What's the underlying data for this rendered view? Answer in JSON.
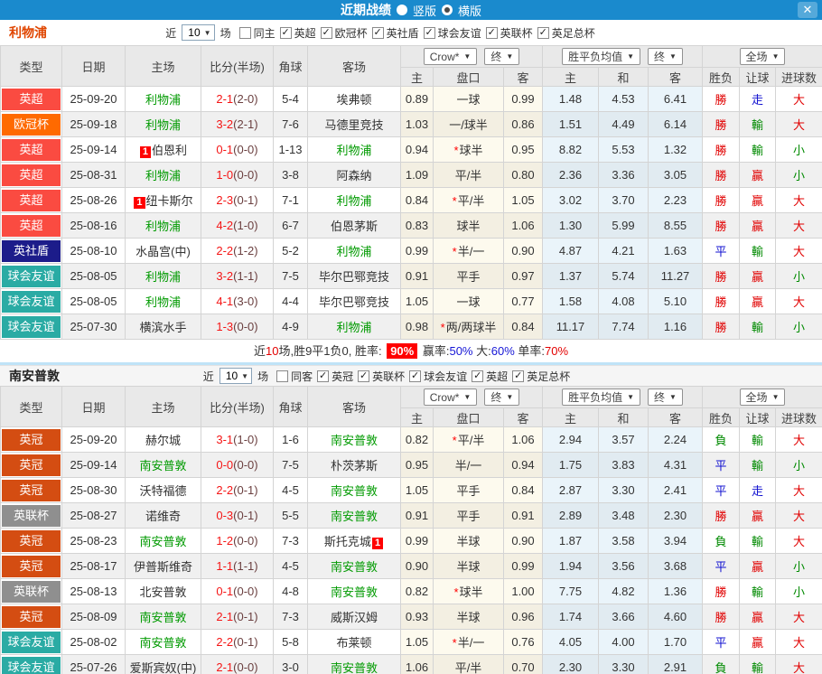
{
  "titlebar": {
    "title": "近期战绩",
    "vertical_label": "竖版",
    "horizontal_label": "横版",
    "close_label": "✕"
  },
  "columns": {
    "main": [
      "类型",
      "日期",
      "主场",
      "比分(半场)",
      "角球",
      "客场"
    ],
    "sub": [
      "主",
      "盘口",
      "客",
      "主",
      "和",
      "客",
      "胜负",
      "让球",
      "进球数"
    ]
  },
  "dropdowns": {
    "crow": "Crow*",
    "end1": "终",
    "avg": "胜平负均值",
    "end2": "终",
    "full": "全场"
  },
  "colors": {
    "accent": "#1a8acd",
    "types": {
      "英超": "#fa4b41",
      "欧冠杯": "#ff6a00",
      "英社盾": "#1c1c8a",
      "球会友谊": "#2aaba4",
      "英冠": "#d44d12",
      "英联杯": "#8f8f8f"
    },
    "results": {
      "勝": "#e10000",
      "負": "#008a00",
      "平": "#1010d0",
      "贏": "#e10000",
      "輸": "#008a00",
      "走": "#1010d0",
      "大": "#e10000",
      "小": "#008a00"
    },
    "team_green": "#009a00"
  },
  "sections": [
    {
      "team": "利物浦",
      "team_color": "#e04500",
      "filter": {
        "prefix": "近",
        "games": "10",
        "suffix": "场",
        "solo": "同主",
        "checked": [
          "英超",
          "欧冠杯",
          "英社盾",
          "球会友谊",
          "英联杯",
          "英足总杯"
        ]
      },
      "rows": [
        {
          "type": "英超",
          "date": "25-09-20",
          "home": "利物浦",
          "home_green": true,
          "home_badge": "",
          "away": "埃弗顿",
          "away_green": false,
          "away_badge": "",
          "score": "2-1",
          "half": "(2-0)",
          "corner": "5-4",
          "o1": "0.89",
          "hc": "一球",
          "o2": "0.99",
          "e1": "1.48",
          "e2": "4.53",
          "e3": "6.41",
          "r1": "勝",
          "r2": "走",
          "r3": "大"
        },
        {
          "type": "欧冠杯",
          "date": "25-09-18",
          "home": "利物浦",
          "home_green": true,
          "home_badge": "",
          "away": "马德里竞技",
          "away_green": false,
          "away_badge": "",
          "score": "3-2",
          "half": "(2-1)",
          "corner": "7-6",
          "o1": "1.03",
          "hc": "一/球半",
          "o2": "0.86",
          "e1": "1.51",
          "e2": "4.49",
          "e3": "6.14",
          "r1": "勝",
          "r2": "輸",
          "r3": "大"
        },
        {
          "type": "英超",
          "date": "25-09-14",
          "home": "伯恩利",
          "home_green": false,
          "home_badge": "1",
          "away": "利物浦",
          "away_green": true,
          "away_badge": "",
          "score": "0-1",
          "half": "(0-0)",
          "corner": "1-13",
          "o1": "0.94",
          "hc": "*球半",
          "o2": "0.95",
          "e1": "8.82",
          "e2": "5.53",
          "e3": "1.32",
          "r1": "勝",
          "r2": "輸",
          "r3": "小"
        },
        {
          "type": "英超",
          "date": "25-08-31",
          "home": "利物浦",
          "home_green": true,
          "home_badge": "",
          "away": "阿森纳",
          "away_green": false,
          "away_badge": "",
          "score": "1-0",
          "half": "(0-0)",
          "corner": "3-8",
          "o1": "1.09",
          "hc": "平/半",
          "o2": "0.80",
          "e1": "2.36",
          "e2": "3.36",
          "e3": "3.05",
          "r1": "勝",
          "r2": "贏",
          "r3": "小"
        },
        {
          "type": "英超",
          "date": "25-08-26",
          "home": "纽卡斯尔",
          "home_green": false,
          "home_badge": "1",
          "away": "利物浦",
          "away_green": true,
          "away_badge": "",
          "score": "2-3",
          "half": "(0-1)",
          "corner": "7-1",
          "o1": "0.84",
          "hc": "*平/半",
          "o2": "1.05",
          "e1": "3.02",
          "e2": "3.70",
          "e3": "2.23",
          "r1": "勝",
          "r2": "贏",
          "r3": "大"
        },
        {
          "type": "英超",
          "date": "25-08-16",
          "home": "利物浦",
          "home_green": true,
          "home_badge": "",
          "away": "伯恩茅斯",
          "away_green": false,
          "away_badge": "",
          "score": "4-2",
          "half": "(1-0)",
          "corner": "6-7",
          "o1": "0.83",
          "hc": "球半",
          "o2": "1.06",
          "e1": "1.30",
          "e2": "5.99",
          "e3": "8.55",
          "r1": "勝",
          "r2": "贏",
          "r3": "大"
        },
        {
          "type": "英社盾",
          "date": "25-08-10",
          "home": "水晶宫(中)",
          "home_green": false,
          "home_badge": "",
          "away": "利物浦",
          "away_green": true,
          "away_badge": "",
          "score": "2-2",
          "half": "(1-2)",
          "corner": "5-2",
          "o1": "0.99",
          "hc": "*半/一",
          "o2": "0.90",
          "e1": "4.87",
          "e2": "4.21",
          "e3": "1.63",
          "r1": "平",
          "r2": "輸",
          "r3": "大"
        },
        {
          "type": "球会友谊",
          "date": "25-08-05",
          "home": "利物浦",
          "home_green": true,
          "home_badge": "",
          "away": "毕尔巴鄂竞技",
          "away_green": false,
          "away_badge": "",
          "score": "3-2",
          "half": "(1-1)",
          "corner": "7-5",
          "o1": "0.91",
          "hc": "平手",
          "o2": "0.97",
          "e1": "1.37",
          "e2": "5.74",
          "e3": "11.27",
          "r1": "勝",
          "r2": "贏",
          "r3": "小"
        },
        {
          "type": "球会友谊",
          "date": "25-08-05",
          "home": "利物浦",
          "home_green": true,
          "home_badge": "",
          "away": "毕尔巴鄂竞技",
          "away_green": false,
          "away_badge": "",
          "score": "4-1",
          "half": "(3-0)",
          "corner": "4-4",
          "o1": "1.05",
          "hc": "一球",
          "o2": "0.77",
          "e1": "1.58",
          "e2": "4.08",
          "e3": "5.10",
          "r1": "勝",
          "r2": "贏",
          "r3": "大"
        },
        {
          "type": "球会友谊",
          "date": "25-07-30",
          "home": "横滨水手",
          "home_green": false,
          "home_badge": "",
          "away": "利物浦",
          "away_green": true,
          "away_badge": "",
          "score": "1-3",
          "half": "(0-0)",
          "corner": "4-9",
          "o1": "0.98",
          "hc": "*两/两球半",
          "o2": "0.84",
          "e1": "11.17",
          "e2": "7.74",
          "e3": "1.16",
          "r1": "勝",
          "r2": "輸",
          "r3": "小"
        }
      ],
      "summary": [
        {
          "text": "近",
          "style": "plain"
        },
        {
          "text": "10",
          "style": "red"
        },
        {
          "text": "场,胜9平1负0, 胜率: ",
          "style": "plain"
        },
        {
          "text": "90%",
          "style": "badge"
        },
        {
          "text": " 赢率:",
          "style": "plain"
        },
        {
          "text": "50%",
          "style": "blue"
        },
        {
          "text": " 大:",
          "style": "plain"
        },
        {
          "text": "60%",
          "style": "blue"
        },
        {
          "text": " 单率:",
          "style": "plain"
        },
        {
          "text": "70%",
          "style": "red"
        }
      ]
    },
    {
      "team": "南安普敦",
      "team_color": "#222222",
      "filter": {
        "prefix": "近",
        "games": "10",
        "suffix": "场",
        "solo": "同客",
        "checked": [
          "英冠",
          "英联杯",
          "球会友谊",
          "英超",
          "英足总杯"
        ]
      },
      "rows": [
        {
          "type": "英冠",
          "date": "25-09-20",
          "home": "赫尔城",
          "home_green": false,
          "home_badge": "",
          "away": "南安普敦",
          "away_green": true,
          "away_badge": "",
          "score": "3-1",
          "half": "(1-0)",
          "corner": "1-6",
          "o1": "0.82",
          "hc": "*平/半",
          "o2": "1.06",
          "e1": "2.94",
          "e2": "3.57",
          "e3": "2.24",
          "r1": "負",
          "r2": "輸",
          "r3": "大"
        },
        {
          "type": "英冠",
          "date": "25-09-14",
          "home": "南安普敦",
          "home_green": true,
          "home_badge": "",
          "away": "朴茨茅斯",
          "away_green": false,
          "away_badge": "",
          "score": "0-0",
          "half": "(0-0)",
          "corner": "7-5",
          "o1": "0.95",
          "hc": "半/一",
          "o2": "0.94",
          "e1": "1.75",
          "e2": "3.83",
          "e3": "4.31",
          "r1": "平",
          "r2": "輸",
          "r3": "小"
        },
        {
          "type": "英冠",
          "date": "25-08-30",
          "home": "沃特福德",
          "home_green": false,
          "home_badge": "",
          "away": "南安普敦",
          "away_green": true,
          "away_badge": "",
          "score": "2-2",
          "half": "(0-1)",
          "corner": "4-5",
          "o1": "1.05",
          "hc": "平手",
          "o2": "0.84",
          "e1": "2.87",
          "e2": "3.30",
          "e3": "2.41",
          "r1": "平",
          "r2": "走",
          "r3": "大"
        },
        {
          "type": "英联杯",
          "date": "25-08-27",
          "home": "诺维奇",
          "home_green": false,
          "home_badge": "",
          "away": "南安普敦",
          "away_green": true,
          "away_badge": "",
          "score": "0-3",
          "half": "(0-1)",
          "corner": "5-5",
          "o1": "0.91",
          "hc": "平手",
          "o2": "0.91",
          "e1": "2.89",
          "e2": "3.48",
          "e3": "2.30",
          "r1": "勝",
          "r2": "贏",
          "r3": "大"
        },
        {
          "type": "英冠",
          "date": "25-08-23",
          "home": "南安普敦",
          "home_green": true,
          "home_badge": "",
          "away": "斯托克城",
          "away_green": false,
          "away_badge": "1",
          "score": "1-2",
          "half": "(0-0)",
          "corner": "7-3",
          "o1": "0.99",
          "hc": "半球",
          "o2": "0.90",
          "e1": "1.87",
          "e2": "3.58",
          "e3": "3.94",
          "r1": "負",
          "r2": "輸",
          "r3": "大"
        },
        {
          "type": "英冠",
          "date": "25-08-17",
          "home": "伊普斯维奇",
          "home_green": false,
          "home_badge": "",
          "away": "南安普敦",
          "away_green": true,
          "away_badge": "",
          "score": "1-1",
          "half": "(1-1)",
          "corner": "4-5",
          "o1": "0.90",
          "hc": "半球",
          "o2": "0.99",
          "e1": "1.94",
          "e2": "3.56",
          "e3": "3.68",
          "r1": "平",
          "r2": "贏",
          "r3": "小"
        },
        {
          "type": "英联杯",
          "date": "25-08-13",
          "home": "北安普敦",
          "home_green": false,
          "home_badge": "",
          "away": "南安普敦",
          "away_green": true,
          "away_badge": "",
          "score": "0-1",
          "half": "(0-0)",
          "corner": "4-8",
          "o1": "0.82",
          "hc": "*球半",
          "o2": "1.00",
          "e1": "7.75",
          "e2": "4.82",
          "e3": "1.36",
          "r1": "勝",
          "r2": "輸",
          "r3": "小"
        },
        {
          "type": "英冠",
          "date": "25-08-09",
          "home": "南安普敦",
          "home_green": true,
          "home_badge": "",
          "away": "威斯汉姆",
          "away_green": false,
          "away_badge": "",
          "score": "2-1",
          "half": "(0-1)",
          "corner": "7-3",
          "o1": "0.93",
          "hc": "半球",
          "o2": "0.96",
          "e1": "1.74",
          "e2": "3.66",
          "e3": "4.60",
          "r1": "勝",
          "r2": "贏",
          "r3": "大"
        },
        {
          "type": "球会友谊",
          "date": "25-08-02",
          "home": "南安普敦",
          "home_green": true,
          "home_badge": "",
          "away": "布莱顿",
          "away_green": false,
          "away_badge": "",
          "score": "2-2",
          "half": "(0-1)",
          "corner": "5-8",
          "o1": "1.05",
          "hc": "*半/一",
          "o2": "0.76",
          "e1": "4.05",
          "e2": "4.00",
          "e3": "1.70",
          "r1": "平",
          "r2": "贏",
          "r3": "大"
        },
        {
          "type": "球会友谊",
          "date": "25-07-26",
          "home": "爱斯宾奴(中)",
          "home_green": false,
          "home_badge": "",
          "away": "南安普敦",
          "away_green": true,
          "away_badge": "",
          "score": "2-1",
          "half": "(0-0)",
          "corner": "3-0",
          "o1": "1.06",
          "hc": "平/半",
          "o2": "0.70",
          "e1": "2.30",
          "e2": "3.30",
          "e3": "2.91",
          "r1": "負",
          "r2": "輸",
          "r3": "大"
        }
      ],
      "summary": null
    }
  ]
}
